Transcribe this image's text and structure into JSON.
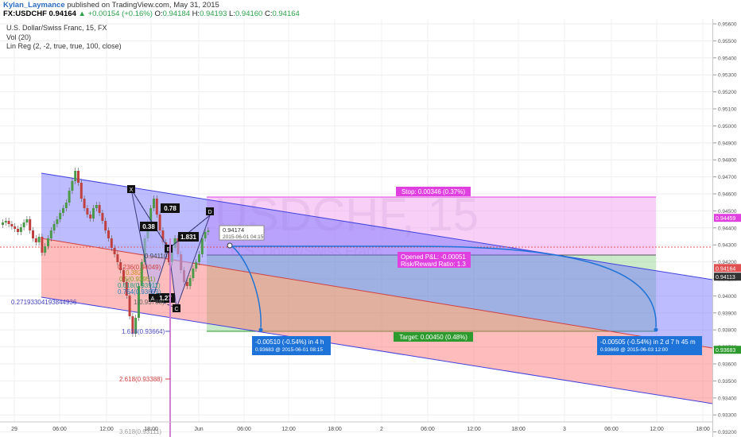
{
  "header": {
    "author": "Kylan_Laymance",
    "published": "published on TradingView.com, May 31, 2015",
    "symbol": "FX:USDCHF",
    "last": "0.94164",
    "change": "+0.00154 (+0.16%)",
    "o_label": "O:",
    "o_value": "0.94184",
    "h_label": "H:",
    "h_value": "0.94193",
    "l_label": "L:",
    "l_value": "0.94160",
    "c_label": "C:",
    "c_value": "0.94164"
  },
  "meta": {
    "instrument": "U.S. Dollar/Swiss Franc, 15, FX",
    "vol": "Vol (20)",
    "linreg": "Lin Reg (2, -2, true, true, 100, close)"
  },
  "watermark": {
    "big": "USDCHF, 15",
    "small": "U.S. Dollar/Swiss Franc"
  },
  "colors": {
    "upper_channel": "#6b6bff",
    "lower_channel": "#ff6b6b",
    "stop_zone": "#f0a8f0",
    "target_zone": "#8ad08a",
    "arrow": "#1e73d8",
    "stop_label": "#e040e0",
    "target_label": "#2c9a2c"
  },
  "price_axis": {
    "ticks": [
      "0.95600",
      "0.95500",
      "0.95400",
      "0.95300",
      "0.95200",
      "0.95100",
      "0.95000",
      "0.94900",
      "0.94800",
      "0.94700",
      "0.94600",
      "0.94500",
      "0.94400",
      "0.94300",
      "0.94200",
      "0.94100",
      "0.94000",
      "0.93900",
      "0.93800",
      "0.93700",
      "0.93600",
      "0.93500",
      "0.93400",
      "0.93300",
      "0.93200"
    ],
    "badges": [
      {
        "value": "0.94459",
        "color": "#e040e0"
      },
      {
        "value": "0.94164",
        "color": "#e05050"
      },
      {
        "value": "0.94113",
        "color": "#333333"
      },
      {
        "value": "0.93683",
        "color": "#2c9a2c"
      }
    ]
  },
  "time_axis": {
    "ticks": [
      "29",
      "06:00",
      "12:00",
      "18:00",
      "Jun",
      "06:00",
      "12:00",
      "18:00",
      "2",
      "06:00",
      "12:00",
      "18:00",
      "3",
      "06:00",
      "12:00",
      "18:00"
    ]
  },
  "pattern": {
    "points": {
      "x": "X",
      "a": "A",
      "b": "B",
      "c": "C",
      "d": "D"
    },
    "ratios": {
      "xb": "0.78",
      "ab": "0.38",
      "bc": "1.27",
      "cd": "1.831"
    }
  },
  "fib_labels": {
    "ch_level": "0.27193304193844936",
    "f0236": "0.236(0.94049)",
    "f0382": "0.382",
    "f05": "0.5(0.93951)",
    "f0618": "0.618(0.93911)",
    "f0764": "0.764(0.93859)",
    "f1": "1(0.93788)",
    "f1618": "1.618(0.93664)",
    "f2618": "2.618(0.93388)",
    "f3618": "3.618(0.93111)",
    "d_price": "0.94110"
  },
  "position": {
    "stop": "Stop: 0.00346 (0.37%)",
    "target": "Target: 0.00450 (0.48%)",
    "opened": "Opened P&L: -0.00051",
    "rr": "Risk/Reward Ratio: 1.3"
  },
  "price_marker": {
    "price": "0.94174",
    "date": "2015-06-01 04:15"
  },
  "measure1": {
    "line1": "-0.00510 (-0.54%) in 4 h",
    "line2": "0.93683 @ 2015-06-01 08:15"
  },
  "measure2": {
    "line1": "-0.00505 (-0.54%) in 2 d 7 h 45 m",
    "line2": "0.93669 @ 2015-06-03 12:00"
  }
}
